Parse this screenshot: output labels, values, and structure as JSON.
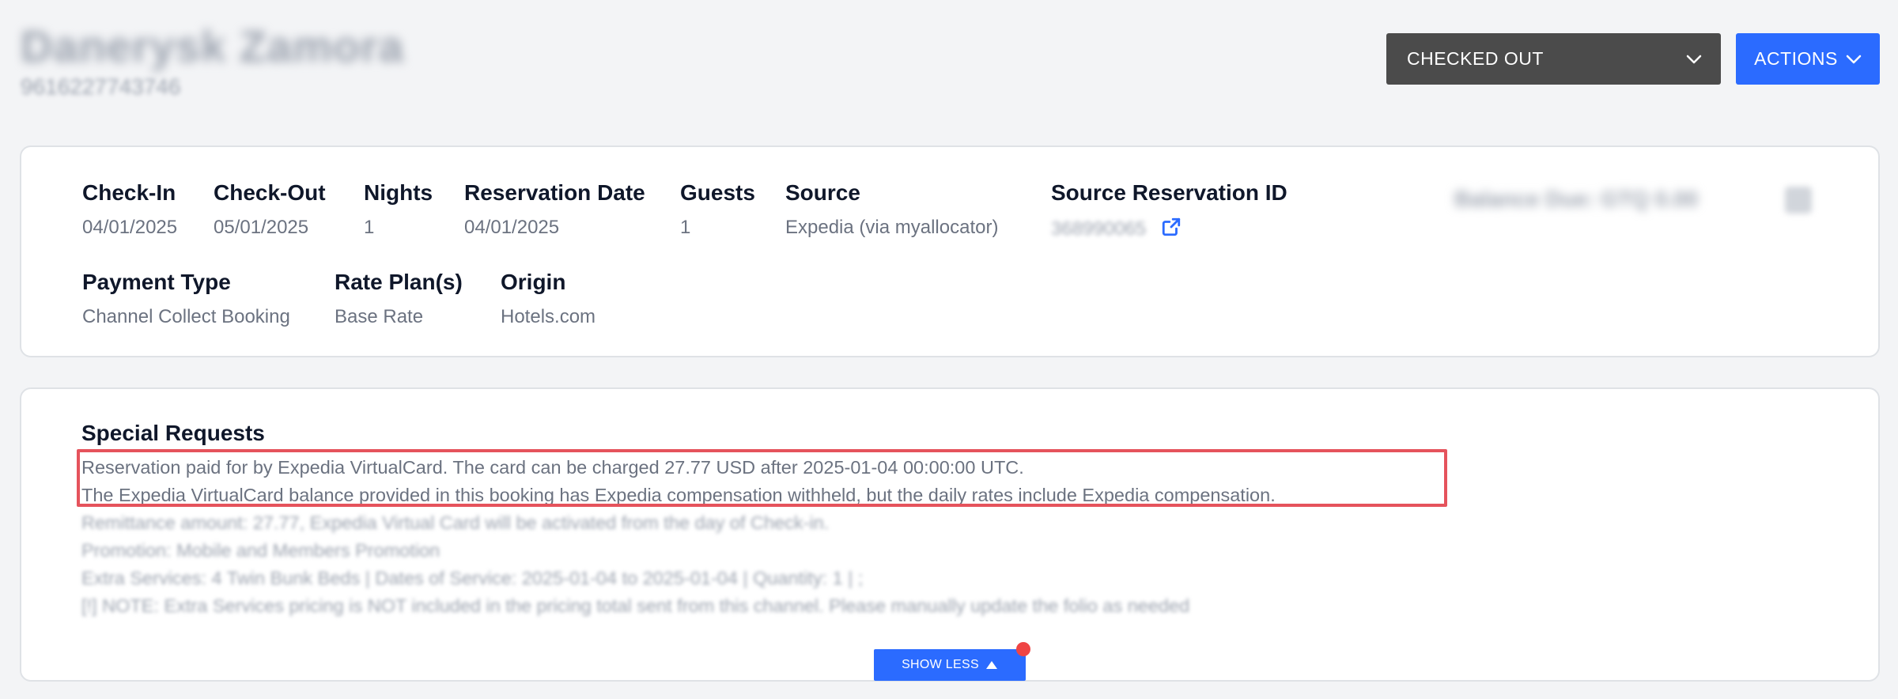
{
  "header": {
    "guest_name": "Danerysk Zamora",
    "guest_id": "9616227743746",
    "status_label": "CHECKED OUT",
    "actions_label": "ACTIONS"
  },
  "details": {
    "check_in": {
      "label": "Check-In",
      "value": "04/01/2025"
    },
    "check_out": {
      "label": "Check-Out",
      "value": "05/01/2025"
    },
    "nights": {
      "label": "Nights",
      "value": "1"
    },
    "reservation_date": {
      "label": "Reservation Date",
      "value": "04/01/2025"
    },
    "guests": {
      "label": "Guests",
      "value": "1"
    },
    "source": {
      "label": "Source",
      "value": "Expedia (via myallocator)"
    },
    "source_reservation_id": {
      "label": "Source Reservation ID",
      "value": "368990065"
    },
    "balance": "Balance Due: GTQ 0.00",
    "payment_type": {
      "label": "Payment Type",
      "value": "Channel Collect Booking"
    },
    "rate_plans": {
      "label": "Rate Plan(s)",
      "value": "Base Rate"
    },
    "origin": {
      "label": "Origin",
      "value": "Hotels.com"
    }
  },
  "special_requests": {
    "title": "Special Requests",
    "lines": [
      "Reservation paid for by Expedia VirtualCard. The card can be charged 27.77 USD after 2025-01-04 00:00:00 UTC.",
      "The Expedia VirtualCard balance provided in this booking has Expedia compensation withheld, but the daily rates include Expedia compensation.",
      "Remittance amount: 27.77, Expedia Virtual Card will be activated from the day of Check-in.",
      "Promotion: Mobile and Members Promotion",
      "Extra Services: 4 Twin Bunk Beds | Dates of Service: 2025-01-04 to 2025-01-04 | Quantity: 1 | ;",
      "[!] NOTE: Extra Services pricing is NOT included in the pricing total sent from this channel. Please manually update the folio as needed"
    ],
    "show_less_label": "SHOW LESS"
  },
  "colors": {
    "primary": "#2b6bff",
    "status_bg": "#4b4b4b",
    "highlight": "#e5535c",
    "notification": "#ef4444"
  },
  "icons": {
    "status_dropdown": "chevron-down-icon",
    "actions": "chevron-down-icon",
    "source_id": "external-link-icon",
    "show_less": "caret-up-icon"
  }
}
